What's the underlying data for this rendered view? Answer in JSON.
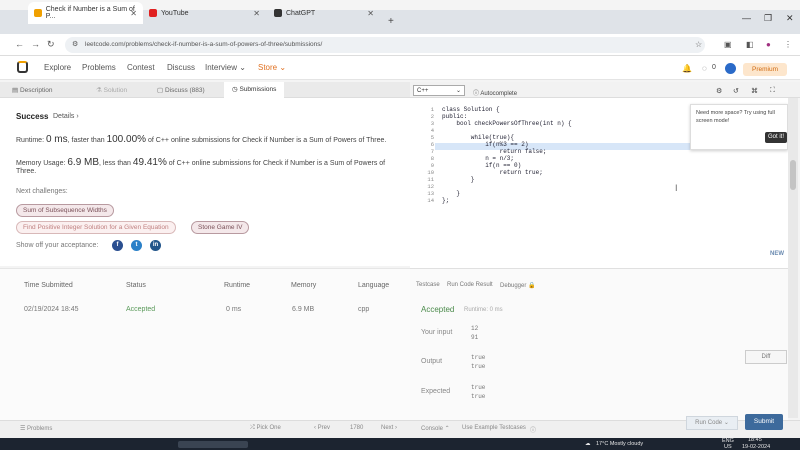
{
  "browser": {
    "tabs": [
      {
        "label": "Check if Number is a Sum of P..."
      },
      {
        "label": "YouTube"
      },
      {
        "label": "ChatGPT"
      }
    ],
    "url": "leetcode.com/problems/check-if-number-is-a-sum-of-powers-of-three/submissions/"
  },
  "site": {
    "nav": [
      "Explore",
      "Problems",
      "Contest",
      "Discuss",
      "Interview",
      "Store"
    ],
    "notif_count": "0",
    "premium": "Premium"
  },
  "left_tabs": [
    "Description",
    "Solution",
    "Discuss (883)",
    "Submissions"
  ],
  "result": {
    "status": "Success",
    "details": "Details",
    "runtime_prefix": "Runtime:",
    "runtime_value": "0 ms",
    "runtime_mid": ", faster than",
    "runtime_pct": "100.00%",
    "runtime_suffix": "of C++ online submissions for Check if Number is a Sum of Powers of Three.",
    "memory_prefix": "Memory Usage:",
    "memory_value": "6.9 MB",
    "memory_mid": ", less than",
    "memory_pct": "49.41%",
    "memory_suffix": "of C++ online submissions for Check if Number is a Sum of Powers of",
    "memory_suffix2": "Three.",
    "next_label": "Next challenges:",
    "challenges": [
      "Sum of Subsequence Widths",
      "Find Positive Integer Solution for a Given Equation",
      "Stone Game IV"
    ],
    "share_label": "Show off your acceptance:"
  },
  "submissions": {
    "headers": [
      "Time Submitted",
      "Status",
      "Runtime",
      "Memory",
      "Language"
    ],
    "rows": [
      {
        "time": "02/19/2024 18:45",
        "status": "Accepted",
        "runtime": "0 ms",
        "memory": "6.9 MB",
        "language": "cpp"
      }
    ]
  },
  "editor": {
    "language": "C++",
    "autocomplete": "Autocomplete",
    "line_numbers": [
      "1",
      "2",
      "3",
      "4",
      "5",
      "6",
      "7",
      "8",
      "9",
      "10",
      "11",
      "12",
      "13",
      "14"
    ],
    "lines": [
      "class Solution {",
      "public:",
      "    bool checkPowersOfThree(int n) {",
      "",
      "        while(true){",
      "            if(n%3 == 2)",
      "                return false;",
      "            n = n/3;",
      "            if(n == 0)",
      "                return true;",
      "        }",
      "",
      "    }",
      "};"
    ],
    "tip_text_1": "Need more space? Try using full",
    "tip_text_2": "screen mode!",
    "tip_button": "Got it!",
    "new_badge": "NEW"
  },
  "console": {
    "tabs": [
      "Testcase",
      "Run Code Result",
      "Debugger"
    ],
    "status": "Accepted",
    "runtime": "Runtime: 0 ms",
    "labels": [
      "Your input",
      "Output",
      "Expected"
    ],
    "input": [
      "12",
      "91"
    ],
    "output": [
      "true",
      "true"
    ],
    "expected": [
      "true",
      "true"
    ],
    "diff": "Diff",
    "run": "Run Code",
    "submit": "Submit"
  },
  "bottom": {
    "problems": "Problems",
    "pick_one": "Pick One",
    "prev": "Prev",
    "page": "1780",
    "next": "Next",
    "console": "Console",
    "example": "Use Example Testcases"
  },
  "taskbar": {
    "weather": "17°C  Mostly cloudy",
    "lang": "ENG",
    "region": "US",
    "time": "18:45",
    "date": "19-02-2024"
  }
}
